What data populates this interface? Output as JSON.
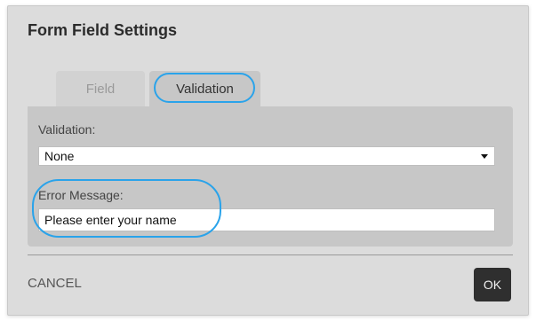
{
  "dialog": {
    "title": "Form Field Settings"
  },
  "tabs": [
    {
      "label": "Field",
      "active": false
    },
    {
      "label": "Validation",
      "active": true
    }
  ],
  "validation": {
    "label": "Validation:",
    "selected": "None"
  },
  "error_message": {
    "label": "Error Message:",
    "value": "Please enter your name"
  },
  "footer": {
    "cancel_label": "CANCEL",
    "ok_label": "OK"
  },
  "colors": {
    "highlight": "#2aa3ea",
    "ok_button": "#2f2f2f",
    "dialog_bg": "#dcdcdc",
    "panel_bg": "#c7c7c7"
  }
}
